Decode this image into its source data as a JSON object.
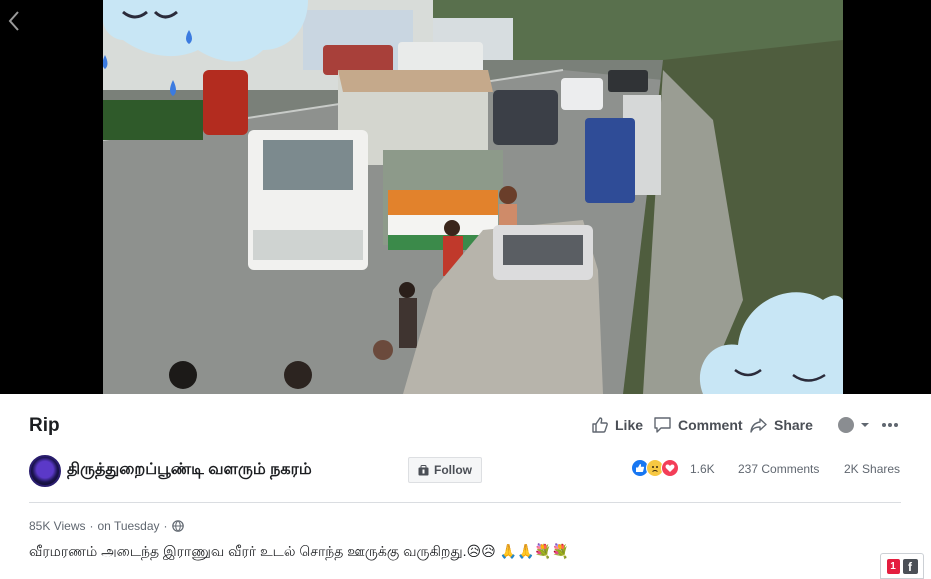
{
  "video": {
    "title": "Rip"
  },
  "actions": {
    "like_label": "Like",
    "comment_label": "Comment",
    "share_label": "Share"
  },
  "page": {
    "name": "திருத்துறைப்பூண்டி வளரும் நகரம்",
    "follow_label": "Follow"
  },
  "engagement": {
    "reactions_count": "1.6K",
    "comments": "237 Comments",
    "shares": "2K Shares",
    "reaction_icons": [
      "like-icon",
      "sad-icon",
      "love-icon"
    ]
  },
  "meta": {
    "views": "85K Views",
    "separator": "·",
    "date": "on Tuesday",
    "privacy_icon": "globe-icon"
  },
  "post": {
    "caption": "வீரமரணம் அடைந்த இராணுவ வீரர் உடல் சொந்த ஊருக்கு வருகிறது.😥😥 🙏🙏💐💐"
  },
  "badge": {
    "notification_count": "1",
    "brand_letter": "f"
  },
  "colors": {
    "like_blue": "#1877f2",
    "love_red": "#f33e58",
    "sad_yellow": "#f7c842",
    "text_secondary": "#606770",
    "notification_red": "#e41e3f"
  }
}
